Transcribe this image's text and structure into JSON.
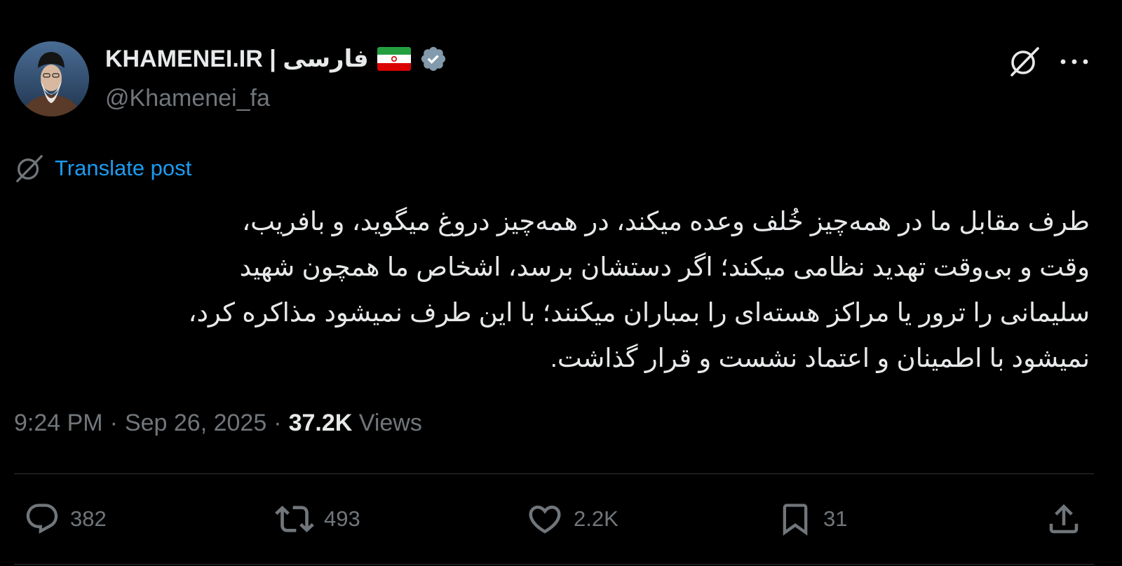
{
  "author": {
    "display_name": "KHAMENEI.IR | فارسی",
    "handle": "@Khamenei_fa",
    "flag_icon": "iran-flag-icon",
    "verified_icon": "verified-badge-icon"
  },
  "header_actions": {
    "grok_icon": "grok-icon",
    "more_icon": "more-icon"
  },
  "translate": {
    "label": "Translate post",
    "icon": "grok-icon"
  },
  "post": {
    "lines": [
      "طرف مقابل ما در همه‌چیز خُلف وعده میکند، در همه‌چیز دروغ میگوید، و بافریب،",
      "وقت و بی‌وقت تهدید نظامی میکند؛ اگر دستشان برسد، اشخاص ما همچون شهید",
      "سلیمانی را ترور یا مراکز هسته‌ای را بمباران میکنند؛ با این طرف نمیشود مذاکره کرد،",
      "نمیشود با اطمینان و اعتماد نشست و قرار گذاشت."
    ]
  },
  "meta": {
    "time": "9:24 PM",
    "separator": "·",
    "date": "Sep 26, 2025",
    "views_count": "37.2K",
    "views_label": "Views"
  },
  "actions": {
    "reply": {
      "icon": "reply-icon",
      "count": "382"
    },
    "repost": {
      "icon": "repost-icon",
      "count": "493"
    },
    "like": {
      "icon": "heart-icon",
      "count": "2.2K"
    },
    "bookmark": {
      "icon": "bookmark-icon",
      "count": "31"
    },
    "share": {
      "icon": "share-icon"
    }
  },
  "colors": {
    "background": "#000000",
    "text": "#e7e9ea",
    "muted": "#71767b",
    "link": "#1d9bf0",
    "divider": "#2f3336",
    "verified": "#829aab"
  }
}
